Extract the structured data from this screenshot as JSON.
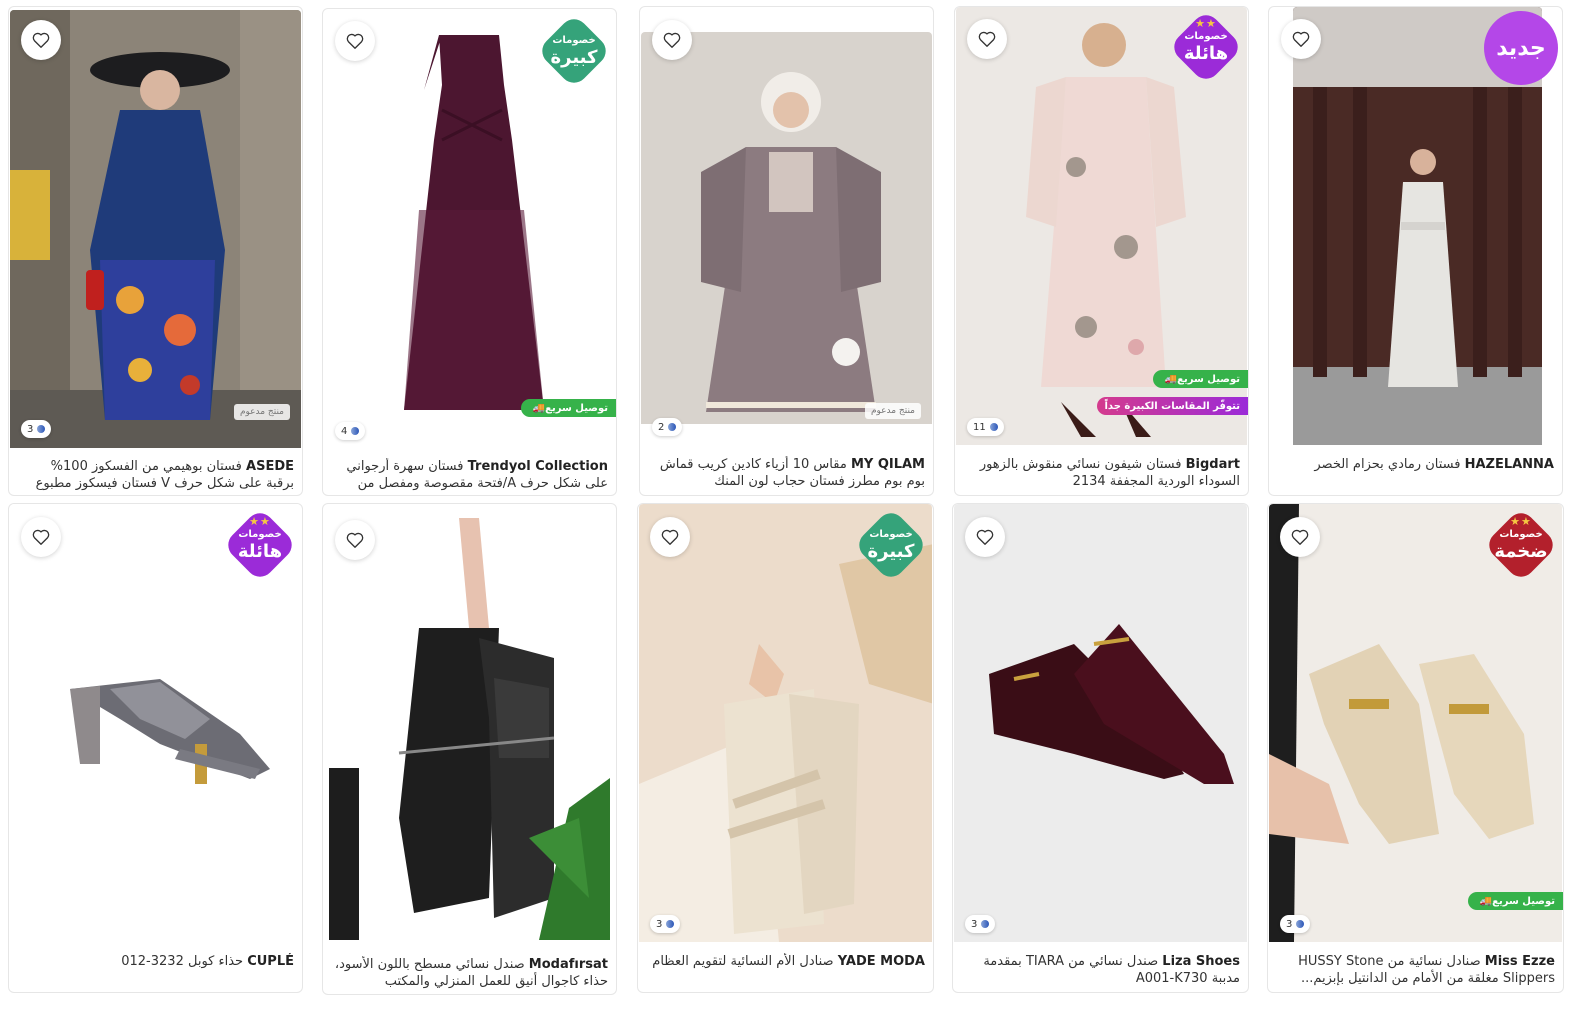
{
  "icons": {
    "favorite": "heart-outline-icon",
    "fast_delivery": "truck-icon",
    "colors": "color-swatch-icon"
  },
  "colors": {
    "green_tag": "#36b24a",
    "purple_tag": "#9b2bd8",
    "new_badge": "#b447e8",
    "badge_green": "#35a37a",
    "badge_purple": "#9b2bd8",
    "badge_red": "#b3202c"
  },
  "products": [
    {
      "brand": "ASEDE",
      "name": "فستان بوهيمي من الفسكوز 100% برقبة على شكل حرف V فستان فيسكوز مطبوع عرقيًا...",
      "colors_count": "3",
      "sponsored": "منتج مدعوم"
    },
    {
      "brand": "Trendyol Collection",
      "name": "فستان سهرة أرجواني على شكل حرف A/فتحة مقصوصة ومفصل من التول...",
      "colors_count": "4",
      "badge": {
        "top": "خصومات",
        "main": "كبيرة"
      },
      "tag": "توصيل سريع"
    },
    {
      "brand": "MY QILAM",
      "name": "مقاس 10 أزياء كادين كريب قماش بوم بوم مطرز فستان حجاب لون المنك",
      "colors_count": "2",
      "sponsored": "منتج مدعوم"
    },
    {
      "brand": "Bigdart",
      "name": "فستان شيفون نسائي منقوش بالزهور السوداء الوردية المجففة 2134",
      "colors_count": "11",
      "badge": {
        "top": "خصومات",
        "main": "هائلة"
      },
      "tag": "توصيل سريع",
      "tag2": "تتوفّر المقاسات الكبيرة جداً"
    },
    {
      "brand": "HAZELANNA",
      "name": "فستان رمادي بحزام الخصر",
      "new_label": "جديد"
    },
    {
      "brand": "CUPLÉ",
      "name": "حذاء كوبل 3232-012",
      "badge": {
        "top": "خصومات",
        "main": "هائلة"
      }
    },
    {
      "brand": "Modafırsat",
      "name": "صندل نسائي مسطح باللون الأسود، حذاء كاجوال أنيق للعمل المنزلي والمكتب"
    },
    {
      "brand": "YADE MODA",
      "name": "صنادل الأم النسائية لتقويم العظام",
      "colors_count": "3",
      "badge": {
        "top": "خصومات",
        "main": "كبيرة"
      }
    },
    {
      "brand": "Liza Shoes",
      "name": "صندل نسائي من TIARA بمقدمة مدببة A001-K730",
      "colors_count": "3"
    },
    {
      "brand": "Miss Ezze",
      "name": "صنادل نسائية من HUSSY Stone Slippers مغلقة من الأمام من الدانتيل بإبزيم...",
      "colors_count": "3",
      "badge": {
        "top": "خصومات",
        "main": "ضخمة"
      },
      "tag": "توصيل سريع"
    }
  ]
}
